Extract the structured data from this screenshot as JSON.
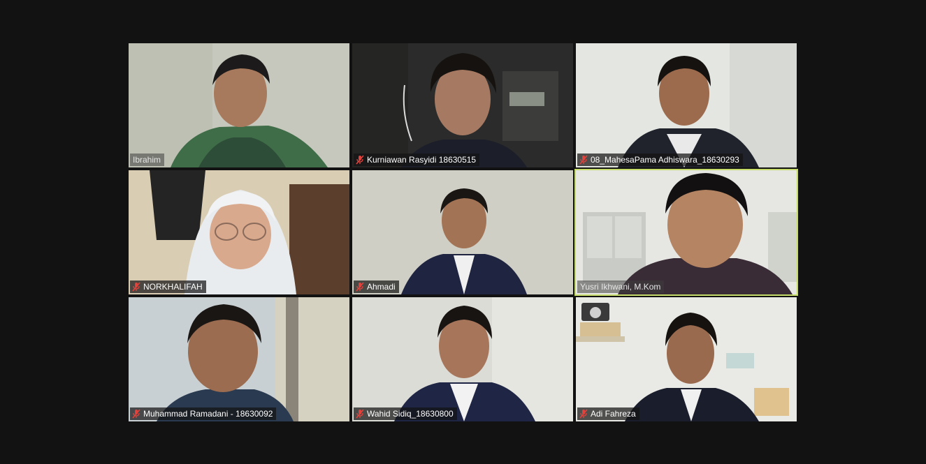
{
  "meeting": {
    "participants": [
      {
        "name": "Ibrahim",
        "muted": false,
        "active": false
      },
      {
        "name": "Kurniawan Rasyidi 18630515",
        "muted": true,
        "active": false
      },
      {
        "name": "08_MahesaPama Adhiswara_18630293",
        "muted": true,
        "active": false
      },
      {
        "name": "NORKHALIFAH",
        "muted": true,
        "active": false
      },
      {
        "name": "Ahmadi",
        "muted": true,
        "active": false
      },
      {
        "name": "Yusri Ikhwani, M.Kom",
        "muted": false,
        "active": true
      },
      {
        "name": "Muhammad Ramadani - 18630092",
        "muted": true,
        "active": false
      },
      {
        "name": "Wahid Sidiq_18630800",
        "muted": true,
        "active": false
      },
      {
        "name": "Adi Fahreza",
        "muted": true,
        "active": false
      }
    ]
  },
  "colors": {
    "background": "#121212",
    "active_speaker_border": "#c5dc6a",
    "mute_icon": "#e0433d"
  },
  "icons": {
    "mute": "microphone-muted-icon"
  }
}
